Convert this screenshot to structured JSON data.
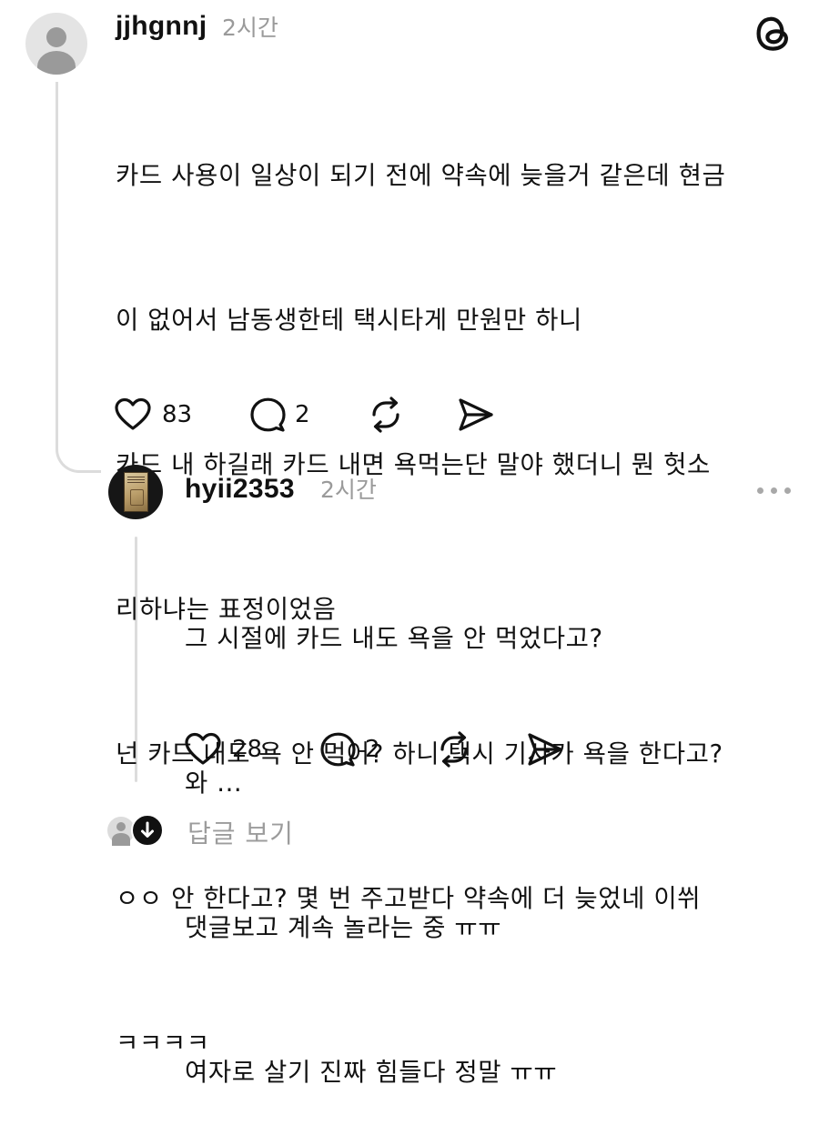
{
  "post": {
    "username": "jjhgnnj",
    "time": "2시간",
    "lines": [
      "카드 사용이 일상이 되기 전에 약속에 늦을거 같은데 현금",
      "이 없어서 남동생한테 택시타게 만원만 하니",
      "카드 내 하길래 카드 내면 욕먹는단 말야 했더니 뭔 헛소",
      "리하냐는 표정이었음",
      "넌 카드 내도 욕 안 먹어? 하니 택시 기사가 욕을 한다고?",
      "ㅇㅇ 안 한다고? 몇 번 주고받다 약속에 더 늦었네 이쒸",
      "ㅋㅋㅋㅋ"
    ],
    "like_count": "83",
    "reply_count": "2",
    "icons": {
      "app_logo": "threads-logo-icon",
      "like": "heart-icon",
      "reply": "comment-bubble-icon",
      "repost": "repost-icon",
      "share": "send-icon"
    }
  },
  "reply": {
    "username": "hyii2353",
    "time": "2시간",
    "lines": [
      "그 시절에 카드 내도 욕을 안 먹었다고?",
      "와 ...",
      "댓글보고 계속 놀라는 중 ㅠㅠ",
      "여자로 살기 진짜 힘들다 정말 ㅠㅠ"
    ],
    "like_count": "28",
    "reply_count": "2",
    "icons": {
      "more": "more-dots-icon",
      "like": "heart-icon",
      "reply": "comment-bubble-icon",
      "repost": "repost-icon",
      "share": "send-icon"
    }
  },
  "footer": {
    "view_replies_label": "답글 보기"
  }
}
